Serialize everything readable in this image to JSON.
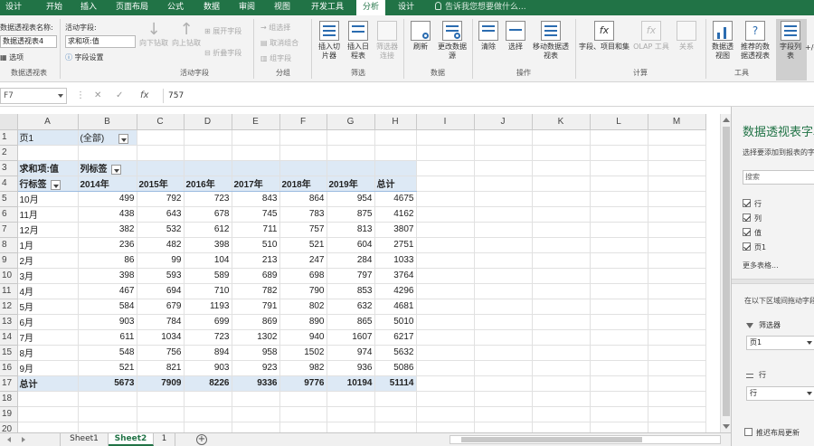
{
  "menu": {
    "tabs": [
      "设计",
      "开始",
      "插入",
      "页面布局",
      "公式",
      "数据",
      "审阅",
      "视图",
      "开发工具",
      "分析",
      "设计"
    ],
    "active_tab": "分析",
    "tell_me": "告诉我您想要做什么..."
  },
  "ribbon": {
    "pivot_name_label": "数据透视表名称:",
    "pivot_name_value": "数据透视表4",
    "options_label": "选项",
    "pivot_group": "数据透视表",
    "active_field_label": "活动字段:",
    "active_field_value": "求和项:值",
    "field_settings_label": "字段设置",
    "drill_down": "向下钻取",
    "drill_up": "向上钻取",
    "expand_field": "展开字段",
    "collapse_field": "折叠字段",
    "active_field_group": "活动字段",
    "group_selection": "组选择",
    "ungroup": "取消组合",
    "group_field": "组字段",
    "group_group": "分组",
    "insert_slicer": "插入切片器",
    "insert_timeline": "插入日程表",
    "filter_connections": "筛选器连接",
    "filter_group": "筛选",
    "refresh": "刷新",
    "change_source": "更改数据源",
    "data_group": "数据",
    "clear": "清除",
    "select": "选择",
    "move_pivot": "移动数据透视表",
    "actions_group": "操作",
    "fields_items": "字段、项目和集",
    "olap_tools": "OLAP 工具",
    "relationships": "关系",
    "calc_group": "计算",
    "pivot_chart": "数据透视图",
    "recommended": "推荐的数据透视表",
    "tools_group": "工具",
    "field_list": "字段列表",
    "plus_minus": "+/-按钮"
  },
  "formula_bar": {
    "cell_ref": "F7",
    "value": "757"
  },
  "grid": {
    "columns": [
      "A",
      "B",
      "C",
      "D",
      "E",
      "F",
      "G",
      "H",
      "I",
      "J",
      "K",
      "L",
      "M"
    ],
    "row_numbers": [
      "1",
      "2",
      "3",
      "4",
      "5",
      "6",
      "7",
      "8",
      "9",
      "10",
      "11",
      "12",
      "13",
      "14",
      "15",
      "16",
      "17",
      "18",
      "19",
      "20"
    ],
    "page_label": "页1",
    "page_value": "(全部)",
    "sum_label": "求和项:值",
    "col_labels": "列标签",
    "row_labels": "行标签",
    "years": [
      "2014年",
      "2015年",
      "2016年",
      "2017年",
      "2018年",
      "2019年",
      "总计"
    ],
    "rows": [
      {
        "label": "10月",
        "values": [
          "499",
          "792",
          "723",
          "843",
          "864",
          "954",
          "4675"
        ]
      },
      {
        "label": "11月",
        "values": [
          "438",
          "643",
          "678",
          "745",
          "783",
          "875",
          "4162"
        ]
      },
      {
        "label": "12月",
        "values": [
          "382",
          "532",
          "612",
          "711",
          "757",
          "813",
          "3807"
        ]
      },
      {
        "label": "1月",
        "values": [
          "236",
          "482",
          "398",
          "510",
          "521",
          "604",
          "2751"
        ]
      },
      {
        "label": "2月",
        "values": [
          "86",
          "99",
          "104",
          "213",
          "247",
          "284",
          "1033"
        ]
      },
      {
        "label": "3月",
        "values": [
          "398",
          "593",
          "589",
          "689",
          "698",
          "797",
          "3764"
        ]
      },
      {
        "label": "4月",
        "values": [
          "467",
          "694",
          "710",
          "782",
          "790",
          "853",
          "4296"
        ]
      },
      {
        "label": "5月",
        "values": [
          "584",
          "679",
          "1193",
          "791",
          "802",
          "632",
          "4681"
        ]
      },
      {
        "label": "6月",
        "values": [
          "903",
          "784",
          "699",
          "869",
          "890",
          "865",
          "5010"
        ]
      },
      {
        "label": "7月",
        "values": [
          "611",
          "1034",
          "723",
          "1302",
          "940",
          "1607",
          "6217"
        ]
      },
      {
        "label": "8月",
        "values": [
          "548",
          "756",
          "894",
          "958",
          "1502",
          "974",
          "5632"
        ]
      },
      {
        "label": "9月",
        "values": [
          "521",
          "821",
          "903",
          "923",
          "982",
          "936",
          "5086"
        ]
      }
    ],
    "total": {
      "label": "总计",
      "values": [
        "5673",
        "7909",
        "8226",
        "9336",
        "9776",
        "10194",
        "51114"
      ]
    }
  },
  "sheets": {
    "tabs": [
      "Sheet1",
      "Sheet2",
      "1"
    ],
    "active": "Sheet2"
  },
  "pane": {
    "title": "数据透视表字段",
    "subtitle": "选择要添加到报表的字段:",
    "search_placeholder": "搜索",
    "fields": [
      {
        "name": "行",
        "checked": true
      },
      {
        "name": "列",
        "checked": true
      },
      {
        "name": "值",
        "checked": true
      },
      {
        "name": "页1",
        "checked": true
      }
    ],
    "more_tables": "更多表格...",
    "drag_hint": "在以下区域间拖动字段:",
    "filter_area_label": "筛选器",
    "filter_area_value": "页1",
    "rows_area_label": "行",
    "rows_area_value": "行",
    "defer_update": "推迟布局更新"
  }
}
